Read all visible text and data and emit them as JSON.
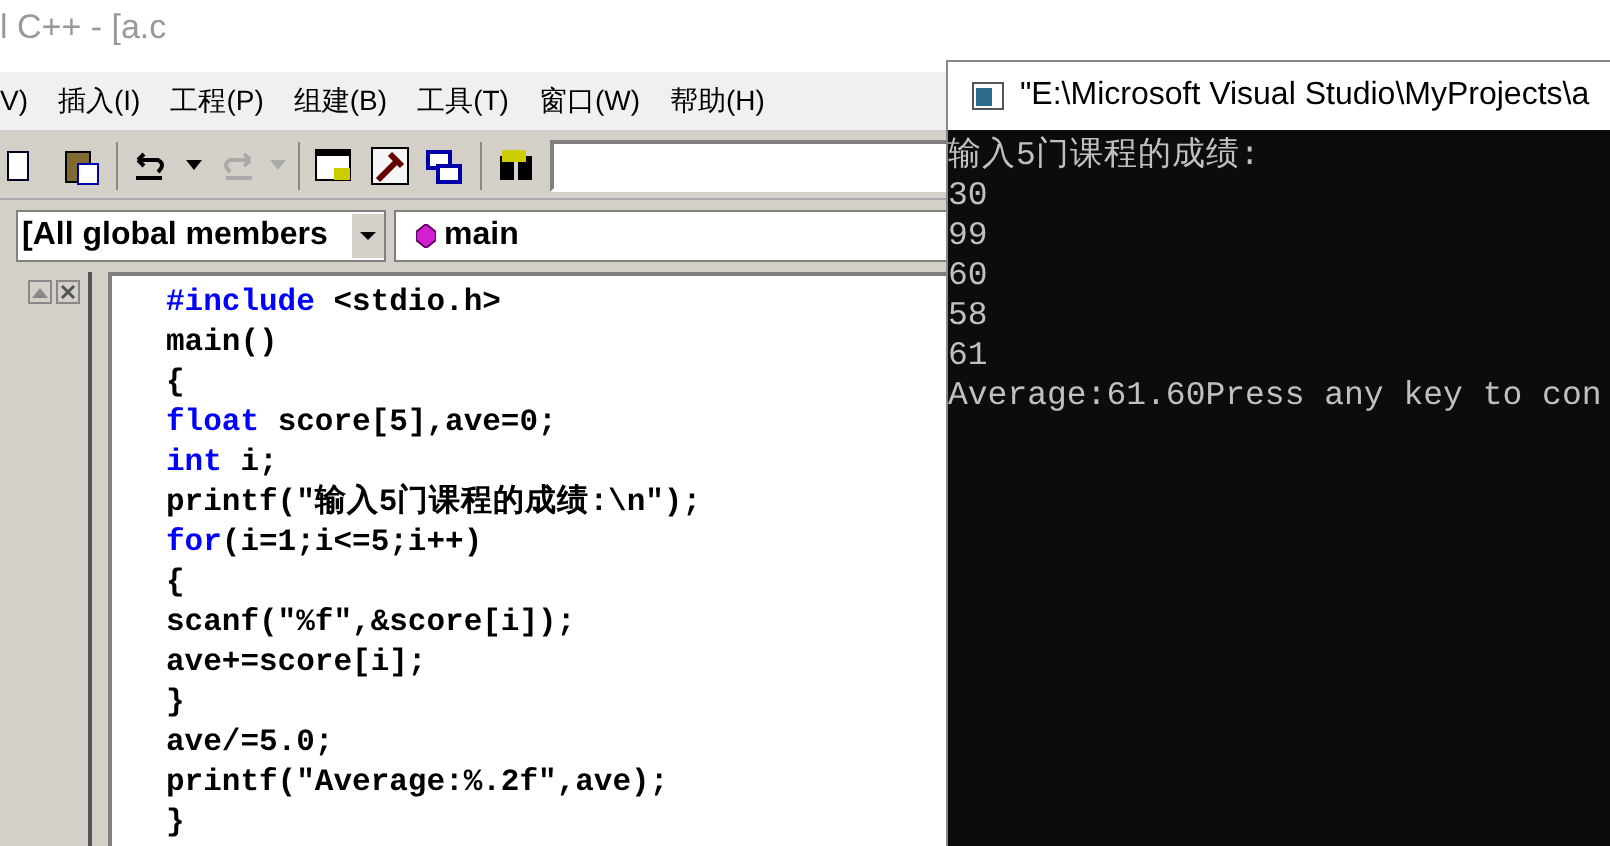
{
  "window": {
    "title": "l C++ - [a.c"
  },
  "menu": [
    "V)",
    "插入(I)",
    "工程(P)",
    "组建(B)",
    "工具(T)",
    "窗口(W)",
    "帮助(H)"
  ],
  "combos": [
    {
      "value": "[All global members"
    },
    {
      "value": "main"
    }
  ],
  "code_lines": [
    [
      {
        "kind": "keyword",
        "text": "#include"
      },
      {
        "kind": "plain",
        "text": " <stdio.h>"
      }
    ],
    [
      {
        "kind": "plain",
        "text": "main()"
      }
    ],
    [
      {
        "kind": "plain",
        "text": "{"
      }
    ],
    [
      {
        "kind": "keyword",
        "text": "float"
      },
      {
        "kind": "plain",
        "text": " score[5],ave=0;"
      }
    ],
    [
      {
        "kind": "keyword",
        "text": "int"
      },
      {
        "kind": "plain",
        "text": " i;"
      }
    ],
    [
      {
        "kind": "plain",
        "text": "printf(\"输入5门课程的成绩:\\n\");"
      }
    ],
    [
      {
        "kind": "keyword",
        "text": "for"
      },
      {
        "kind": "plain",
        "text": "(i=1;i<=5;i++)"
      }
    ],
    [
      {
        "kind": "plain",
        "text": "{"
      }
    ],
    [
      {
        "kind": "plain",
        "text": "scanf(\"%f\",&score[i]);"
      }
    ],
    [
      {
        "kind": "plain",
        "text": "ave+=score[i];"
      }
    ],
    [
      {
        "kind": "plain",
        "text": "}"
      }
    ],
    [
      {
        "kind": "plain",
        "text": "ave/=5.0;"
      }
    ],
    [
      {
        "kind": "plain",
        "text": "printf(\"Average:%.2f\",ave);"
      }
    ],
    [
      {
        "kind": "plain",
        "text": "}"
      }
    ]
  ],
  "console": {
    "title": "\"E:\\Microsoft Visual Studio\\MyProjects\\a",
    "lines": [
      "输入5门课程的成绩:",
      "30",
      "99",
      "60",
      "58",
      "61",
      "Average:61.60Press any key to con"
    ]
  }
}
